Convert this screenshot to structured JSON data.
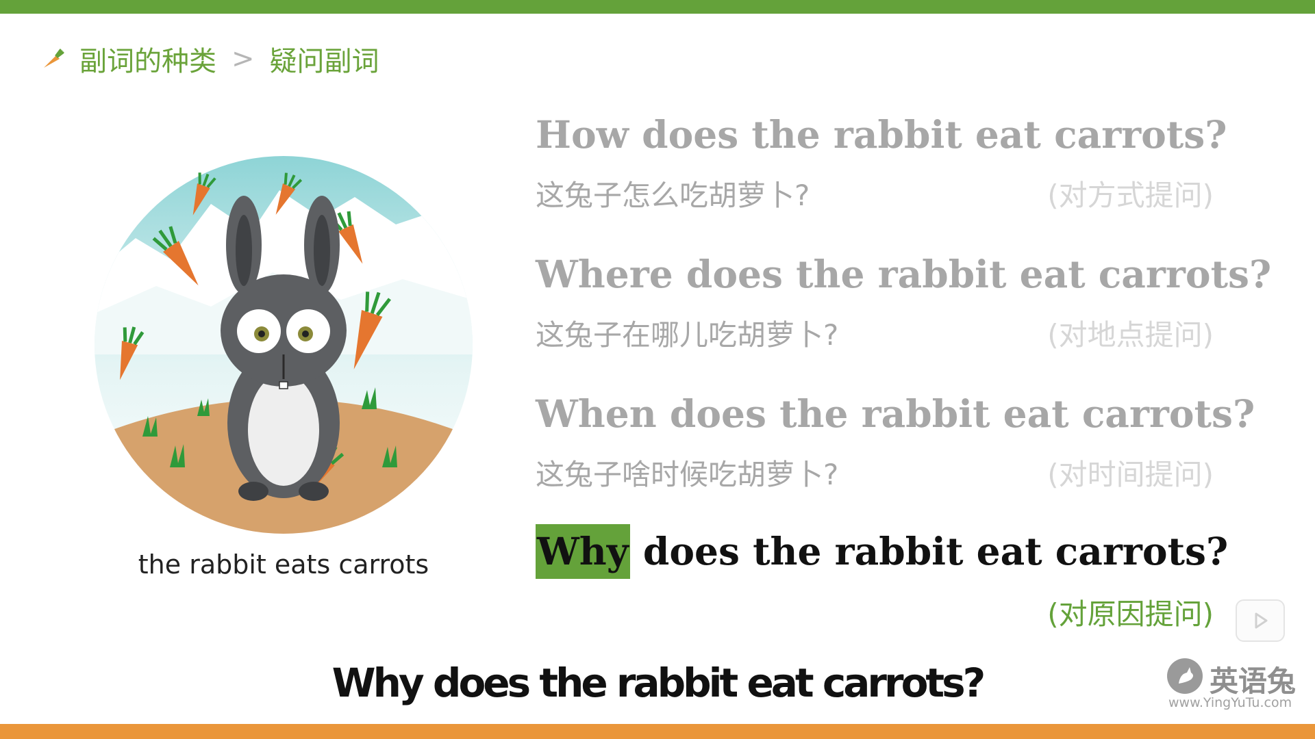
{
  "breadcrumb": {
    "section": "副词的种类",
    "separator": ">",
    "current": "疑问副词"
  },
  "illustration": {
    "caption": "the rabbit eats carrots"
  },
  "questions": [
    {
      "en": "How does the rabbit eat carrots?",
      "zh": "这兔子怎么吃胡萝卜?",
      "tag": "(对方式提问)"
    },
    {
      "en": "Where does the rabbit eat carrots?",
      "zh": "这兔子在哪儿吃胡萝卜?",
      "tag": "(对地点提问)"
    },
    {
      "en": "When does the rabbit eat carrots?",
      "zh": "这兔子啥时候吃胡萝卜?",
      "tag": "(对时间提问)"
    },
    {
      "en_highlight": "Why",
      "en_rest": " does the rabbit eat carrots?",
      "tag": "(对原因提问)"
    }
  ],
  "subtitle": "Why does the rabbit eat carrots?",
  "logo": {
    "brand": "英语兔",
    "url": "www.YingYuTu.com"
  },
  "colors": {
    "accent_green": "#64a23a",
    "accent_orange": "#ea963a",
    "muted_text": "#a7a7a7"
  },
  "icons": {
    "breadcrumb": "carrot-icon",
    "badge": "play-icon",
    "logo": "rabbit-icon"
  }
}
